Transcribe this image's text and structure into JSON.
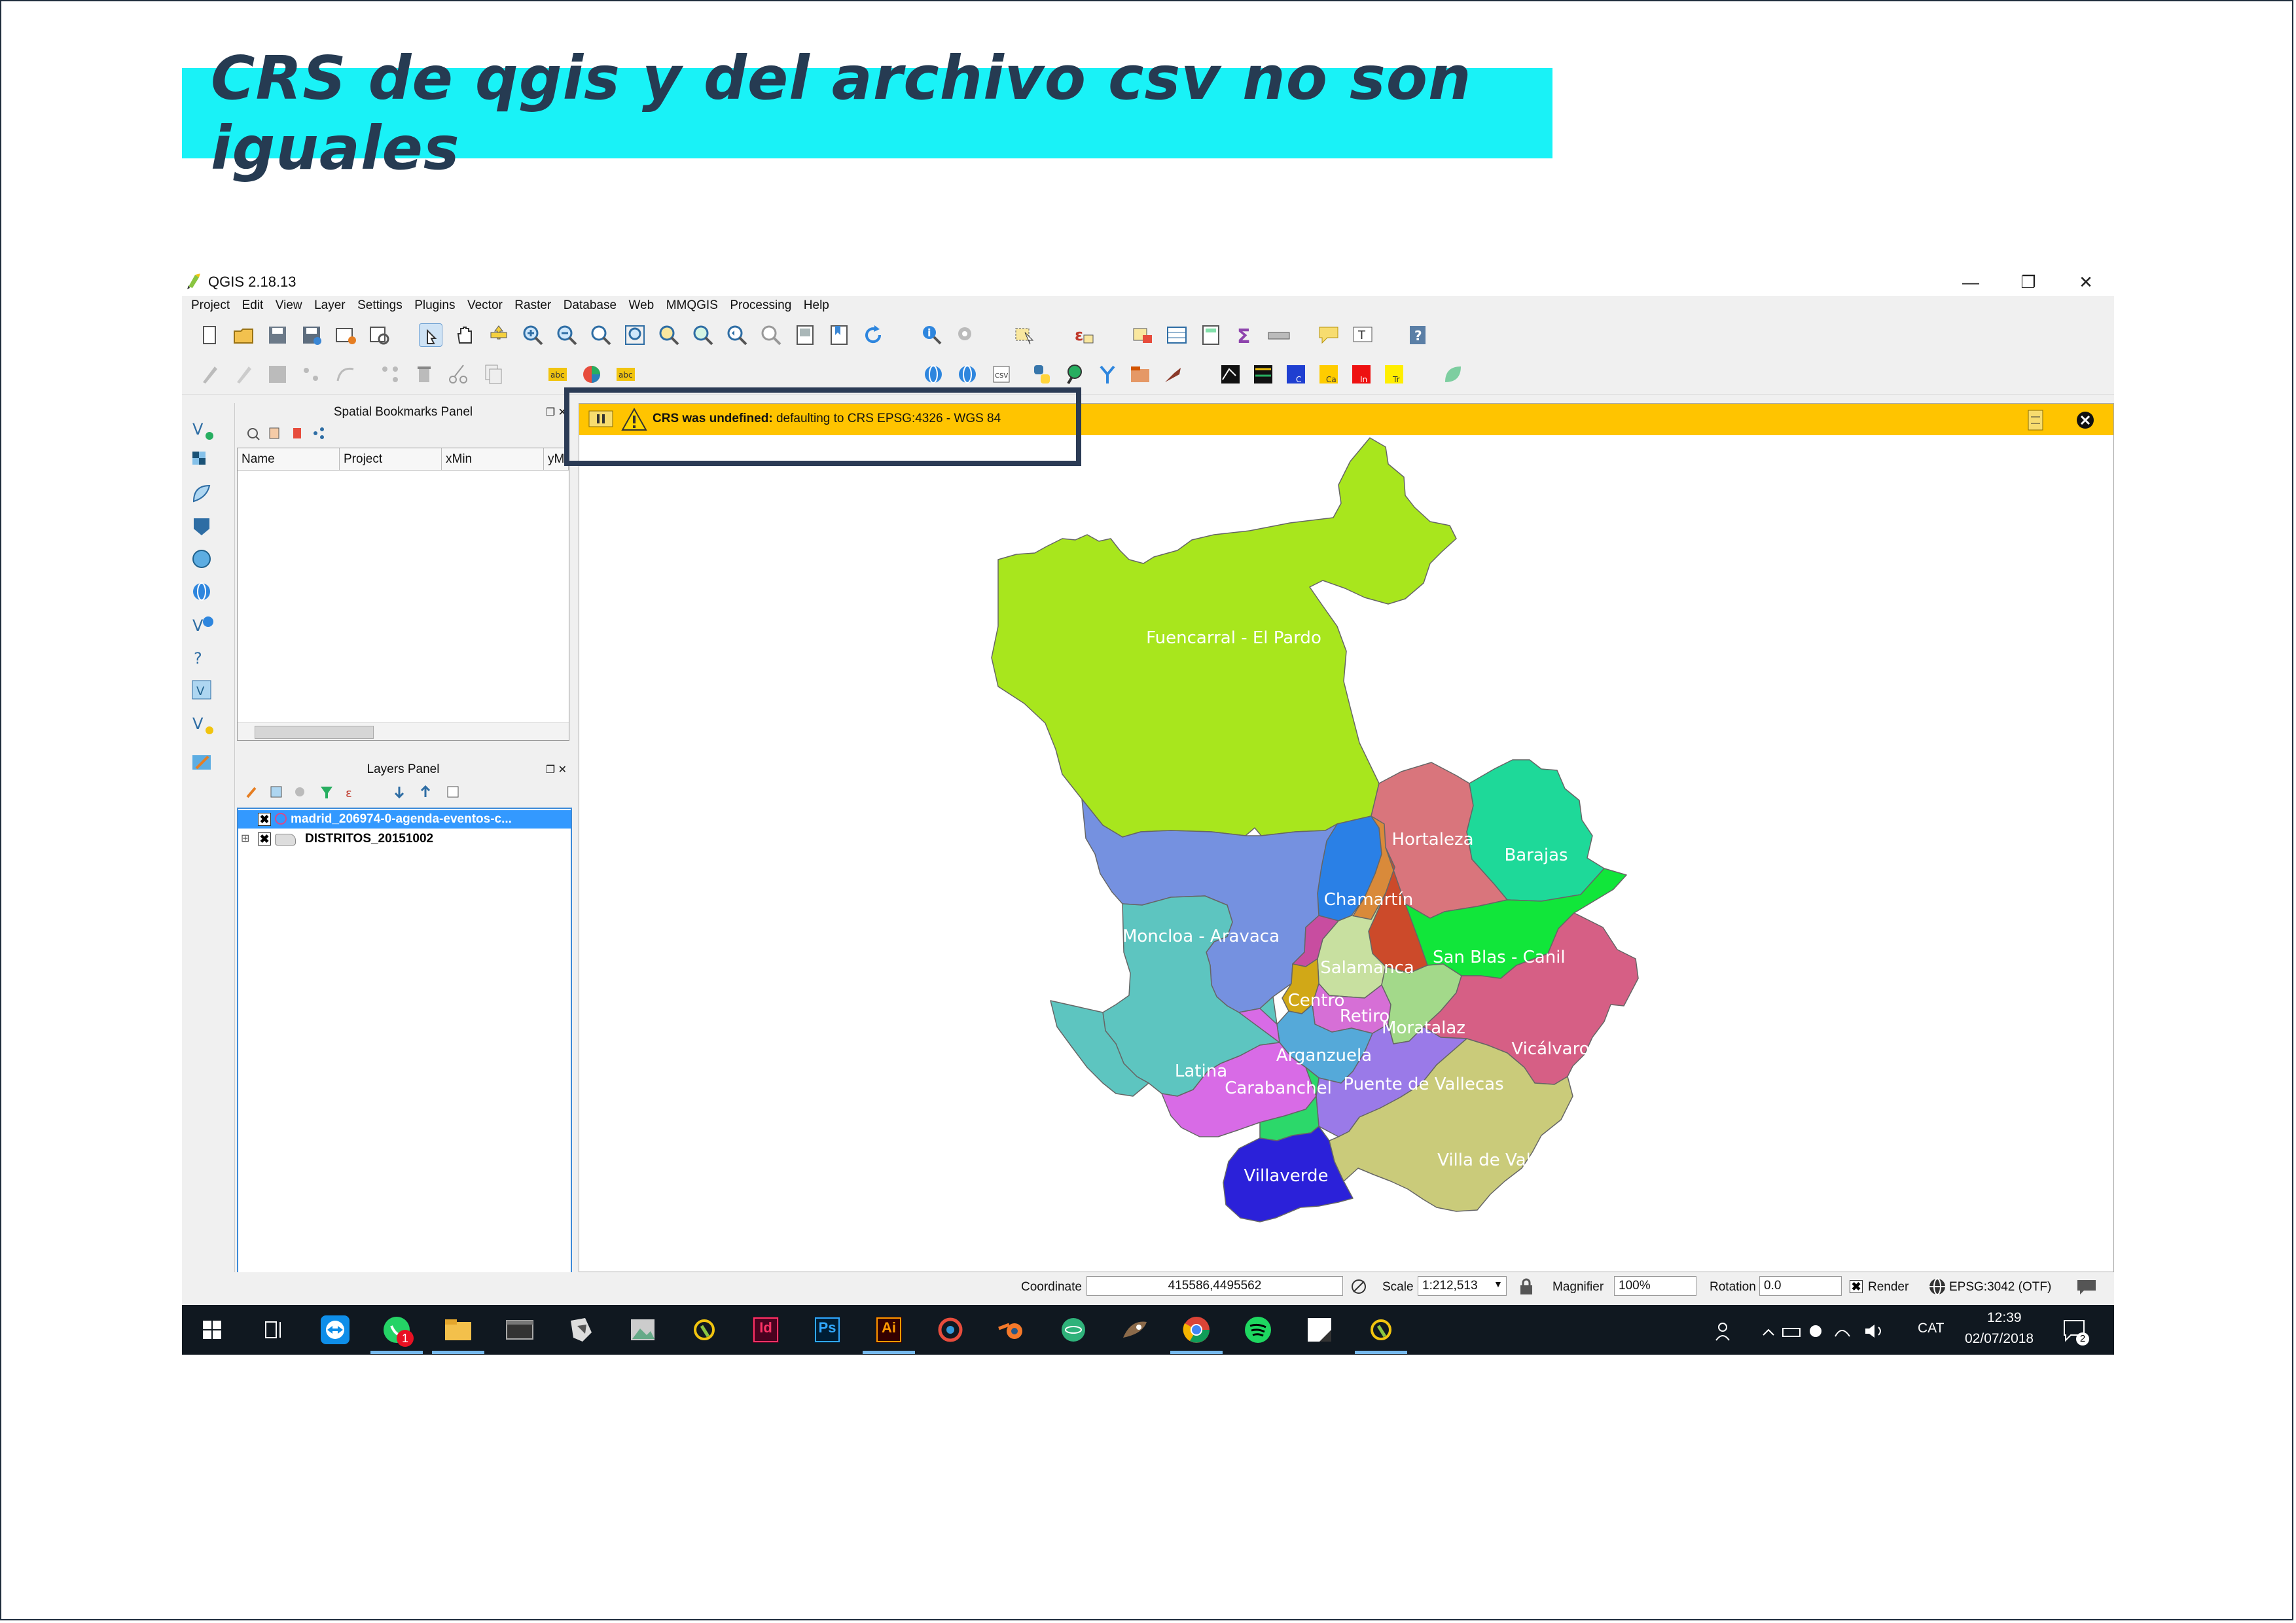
{
  "slide": {
    "title": "CRS de qgis y del archivo csv no son iguales"
  },
  "window": {
    "title": "QGIS 2.18.13",
    "controls": {
      "minimize": "—",
      "restore": "❐",
      "close": "✕"
    }
  },
  "menu": [
    "Project",
    "Edit",
    "View",
    "Layer",
    "Settings",
    "Plugins",
    "Vector",
    "Raster",
    "Database",
    "Web",
    "MMQGIS",
    "Processing",
    "Help"
  ],
  "bookmarks_panel": {
    "title": "Spatial Bookmarks Panel",
    "columns": [
      "Name",
      "Project",
      "xMin",
      "yMin"
    ]
  },
  "layers_panel": {
    "title": "Layers Panel",
    "layers": [
      {
        "name": "madrid_206974-0-agenda-eventos-c...",
        "checked": "✖",
        "selected": true
      },
      {
        "name": "DISTRITOS_20151002",
        "checked": "✖",
        "selected": false
      }
    ]
  },
  "message_bar": {
    "bold": "CRS was undefined:",
    "text": " defaulting to CRS EPSG:4326 - WGS 84",
    "bg_color": "#ffc400"
  },
  "map": {
    "districts": [
      {
        "name": "Fuencarral - El Pardo",
        "color": "#a8e61d"
      },
      {
        "name": "Hortaleza",
        "color": "#d9757c"
      },
      {
        "name": "Barajas",
        "color": "#1ed999"
      },
      {
        "name": "Chamartín",
        "color": "#2a80e6"
      },
      {
        "name": "Moncloa - Aravaca",
        "color": "#7591e0"
      },
      {
        "name": "San Blas - Canillejas",
        "color": "#11e63a"
      },
      {
        "name": "Salamanca",
        "color": "#c8e0a0"
      },
      {
        "name": "Centro",
        "color": "#d1a817"
      },
      {
        "name": "Retiro",
        "color": "#d66fd6"
      },
      {
        "name": "Moratalaz",
        "color": "#a3d98a"
      },
      {
        "name": "Arganzuela",
        "color": "#55a9d9"
      },
      {
        "name": "Vicálvaro",
        "color": "#d65f85"
      },
      {
        "name": "Latina",
        "color": "#5dc5c0"
      },
      {
        "name": "Carabanchel",
        "color": "#d86be6"
      },
      {
        "name": "Puente de Vallecas",
        "color": "#9a7ae8"
      },
      {
        "name": "Villaverde",
        "color": "#2b21d9"
      },
      {
        "name": "Villa de Vallecas",
        "color": "#cacb7a"
      }
    ],
    "visible_labels": {
      "fuencarral": "Fuencarral - El Pardo",
      "hortaleza": "Hortaleza",
      "barajas": "Barajas",
      "chamartin": "Chamartín",
      "moncloa": "Moncloa - Aravaca",
      "sanblas": "San Blas - Canil",
      "salamanca": "Salamanca",
      "centro": "Centro",
      "retiro": "Retiro",
      "moratalaz": "Moratalaz",
      "arganzuela": "Arganzuela",
      "vicalvaro": "Vicálvaro",
      "latina": "Latina",
      "carabanchel": "Carabanchel",
      "puente": "Puente de Vallecas",
      "villaverde": "Villaverde",
      "villa_vallecas": "Villa de Vallecas"
    }
  },
  "status": {
    "coordinate_label": "Coordinate",
    "coordinate_value": "415586,4495562",
    "scale_label": "Scale",
    "scale_value": "1:212,513",
    "magnifier_label": "Magnifier",
    "magnifier_value": "100%",
    "rotation_label": "Rotation",
    "rotation_value": "0.0",
    "render_label": "Render",
    "render_checked": "✖",
    "crs": "EPSG:3042 (OTF)"
  },
  "taskbar": {
    "language": "CAT",
    "time": "12:39",
    "date": "02/07/2018",
    "notification_count": "2",
    "whatsapp_badge": "1",
    "app_labels": {
      "indesign": "Id",
      "photoshop": "Ps",
      "illustrator": "Ai"
    }
  }
}
